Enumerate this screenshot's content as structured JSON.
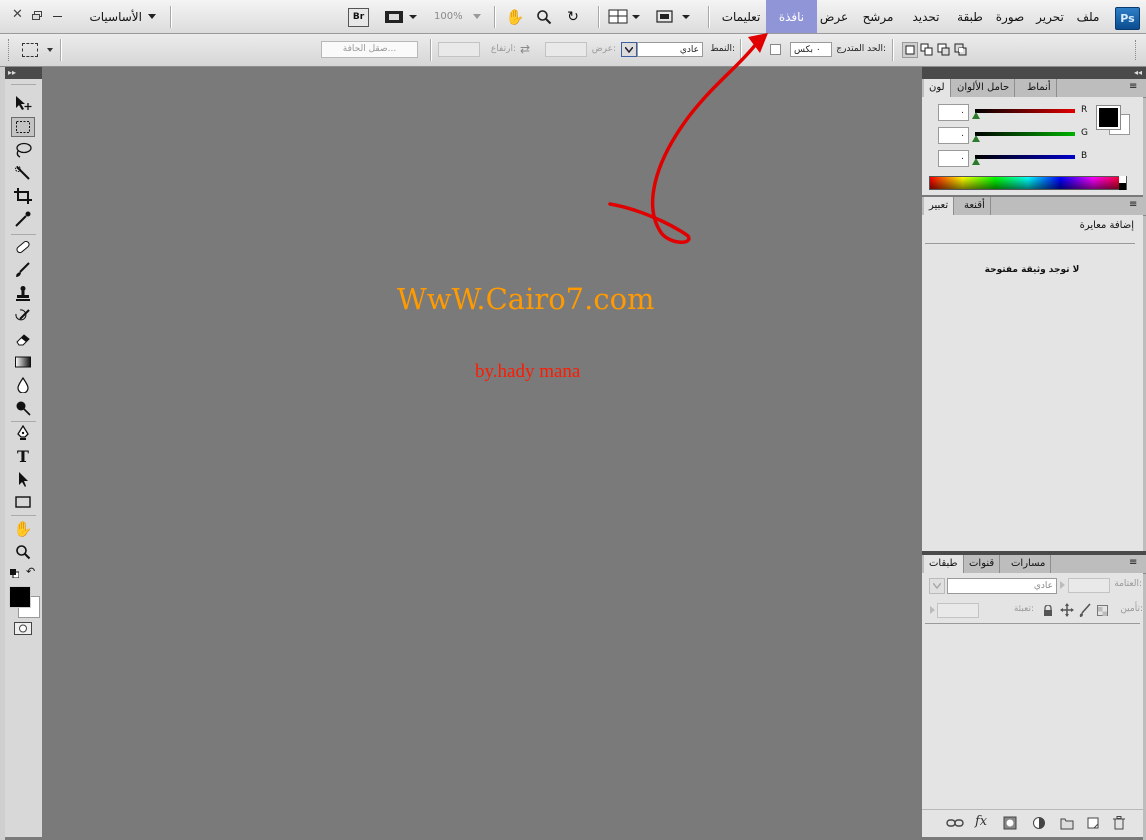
{
  "menubar": {
    "logo": "Ps",
    "items": [
      "ملف",
      "تحرير",
      "صورة",
      "طبقة",
      "تحديد",
      "مرشح",
      "عرض",
      "نافذة",
      "تعليمات"
    ],
    "active": "نافذة",
    "zoom": "100%",
    "bridge": "Br",
    "workspace": "الأساسيات"
  },
  "options": {
    "feather_label": "الحد المتدرج:",
    "feather_value": "٠ بكس",
    "style_label": "النمط:",
    "style_value": "عادي",
    "width_label": "عرض:",
    "height_label": "ارتفاع:",
    "refine_edge": "صقل الحافة..."
  },
  "color_panel": {
    "tabs": [
      "لون",
      "حامل الألوان",
      "أنماط"
    ],
    "channels": [
      {
        "name": "R",
        "value": "٠",
        "color": "#e00000"
      },
      {
        "name": "G",
        "value": "٠",
        "color": "#00b000"
      },
      {
        "name": "B",
        "value": "٠",
        "color": "#0000c8"
      }
    ]
  },
  "adjust_panel": {
    "tabs": [
      "تعبير",
      "أقنعة"
    ],
    "heading": "إضافة معايرة",
    "message": "لا توجد وثيقة مفتوحة"
  },
  "layers_panel": {
    "tabs": [
      "طبقات",
      "قنوات",
      "مسارات"
    ],
    "blend": "عادي",
    "opacity_label": "العتامة:",
    "fill_label": "تعبئة:",
    "lock_label": "تأمين:"
  },
  "canvas": {
    "watermark": "WwW.Cairo7.com",
    "credit": "by.hady mana",
    "watermark_color": "#ff9a00",
    "credit_color": "#ff0000"
  }
}
